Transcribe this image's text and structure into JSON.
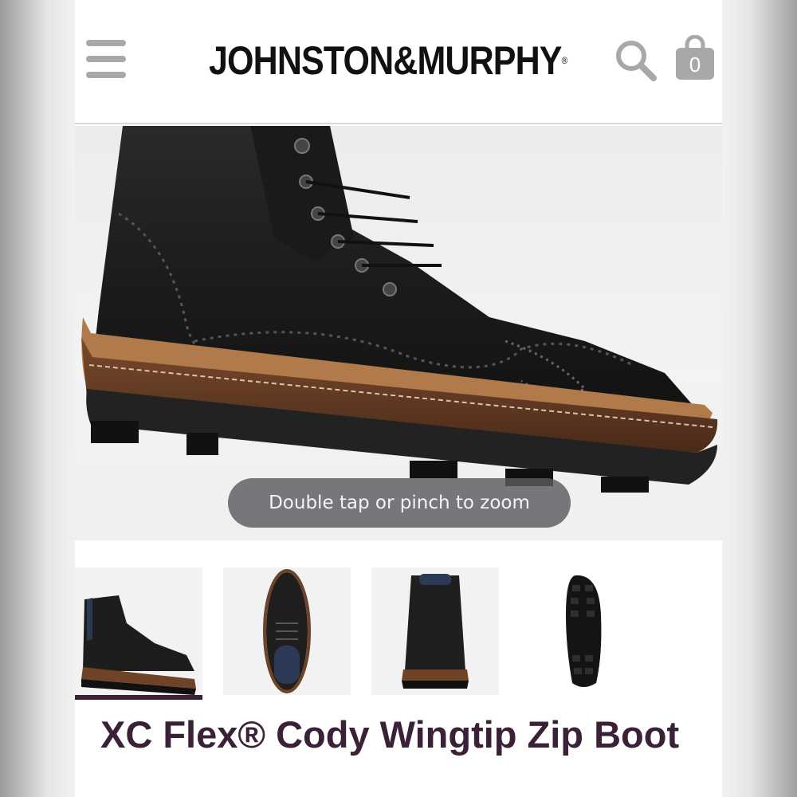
{
  "header": {
    "menu_icon": "hamburger-menu-icon",
    "brand": "JOHNSTON&MURPHY",
    "brand_mark": "®",
    "search_icon": "search-icon",
    "bag_icon": "shopping-bag-icon",
    "bag_count": "0"
  },
  "hero": {
    "image": "black wingtip lace-up boot, side view",
    "zoom_hint": "Double tap or pinch to zoom"
  },
  "thumbnails": [
    {
      "view": "side",
      "selected": true
    },
    {
      "view": "top"
    },
    {
      "view": "back"
    },
    {
      "view": "sole"
    }
  ],
  "product": {
    "title": "XC Flex® Cody Wingtip Zip Boot"
  },
  "colors": {
    "title": "#3b2137",
    "active_thumb_underline": "#3a2338",
    "icon_gray": "#a8a8a8"
  }
}
